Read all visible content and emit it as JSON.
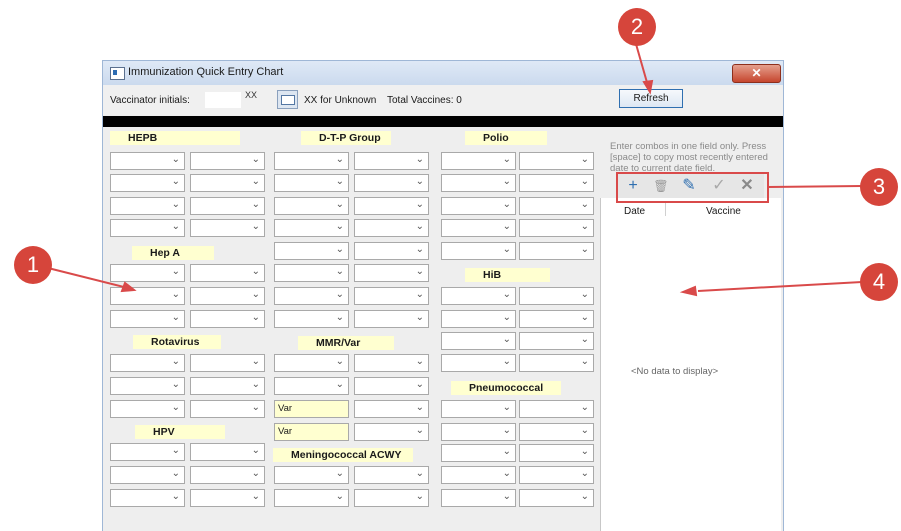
{
  "window": {
    "title": "Immunization Quick Entry Chart",
    "close_glyph": "✕"
  },
  "top": {
    "vaccinator_label": "Vaccinator initials:",
    "initials_value": "XX",
    "unknown_note": "XX for Unknown",
    "total_label": "Total Vaccines: 0",
    "refresh_label": "Refresh"
  },
  "sections": {
    "hepb": "HEPB",
    "hepa": "Hep A",
    "rotavirus": "Rotavirus",
    "hpv": "HPV",
    "dtp": "D-T-P Group",
    "mmrvar": "MMR/Var",
    "mening": "Meningococcal ACWY",
    "polio": "Polio",
    "hib": "HiB",
    "pneumo": "Pneumococcal"
  },
  "prefill": {
    "var1": "Var",
    "var2": "Var"
  },
  "right_panel": {
    "hint": "Enter combos in one field only. Press [space] to copy most recently entered date to current date field.",
    "toolbar": {
      "add": "+",
      "delete": "🗑",
      "edit": "✎",
      "accept": "✓",
      "cancel": "✕"
    },
    "col_date": "Date",
    "col_vaccine": "Vaccine",
    "empty": "<No data to display>"
  },
  "annotations": [
    "1",
    "2",
    "3",
    "4"
  ],
  "colors": {
    "section_bg": "#ffffd0",
    "annotation_red": "#d6453b",
    "arrow_red": "#d94a4a",
    "refresh_border": "#2f6fb0"
  }
}
